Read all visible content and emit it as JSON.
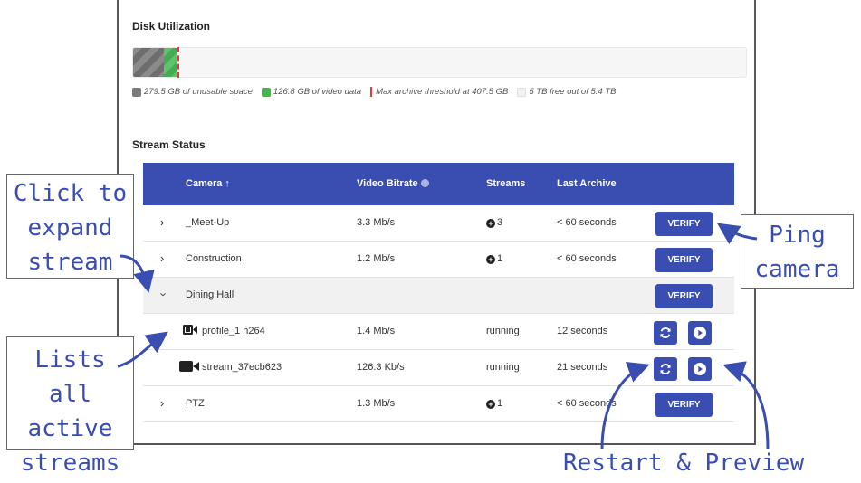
{
  "disk": {
    "title": "Disk Utilization",
    "legend": {
      "unusable": "279.5 GB of unusable space",
      "video": "126.8 GB of video data",
      "threshold": "Max archive threshold at 407.5 GB",
      "free": "5 TB free out of 5.4 TB"
    },
    "fractions": {
      "unusable": 0.05,
      "video": 0.022
    }
  },
  "stream_status": {
    "title": "Stream Status",
    "headers": {
      "camera": "Camera",
      "bitrate": "Video Bitrate",
      "streams": "Streams",
      "last_archive": "Last Archive"
    },
    "rows": [
      {
        "name": "_Meet-Up",
        "bitrate": "3.3 Mb/s",
        "streams": "3",
        "last": "< 60 seconds",
        "action": "VERIFY"
      },
      {
        "name": "Construction",
        "bitrate": "1.2 Mb/s",
        "streams": "1",
        "last": "< 60 seconds",
        "action": "VERIFY"
      },
      {
        "name": "Dining Hall",
        "action": "VERIFY"
      },
      {
        "name": "profile_1 h264",
        "bitrate": "1.4 Mb/s",
        "streams": "running",
        "last": "12 seconds"
      },
      {
        "name": "stream_37ecb623",
        "bitrate": "126.3 Kb/s",
        "streams": "running",
        "last": "21 seconds"
      },
      {
        "name": "PTZ",
        "bitrate": "1.3 Mb/s",
        "streams": "1",
        "last": "< 60 seconds",
        "action": "VERIFY"
      }
    ]
  },
  "annotations": {
    "expand": [
      "Click to",
      "expand",
      "stream"
    ],
    "ping": [
      "Ping",
      "camera"
    ],
    "lists": [
      "Lists all",
      "active",
      "streams"
    ],
    "restart_preview": "Restart & Preview"
  },
  "colors": {
    "accent": "#3a4db1",
    "video": "#4caf50",
    "threshold": "#e53935",
    "unusable": "#7a7a7a"
  }
}
